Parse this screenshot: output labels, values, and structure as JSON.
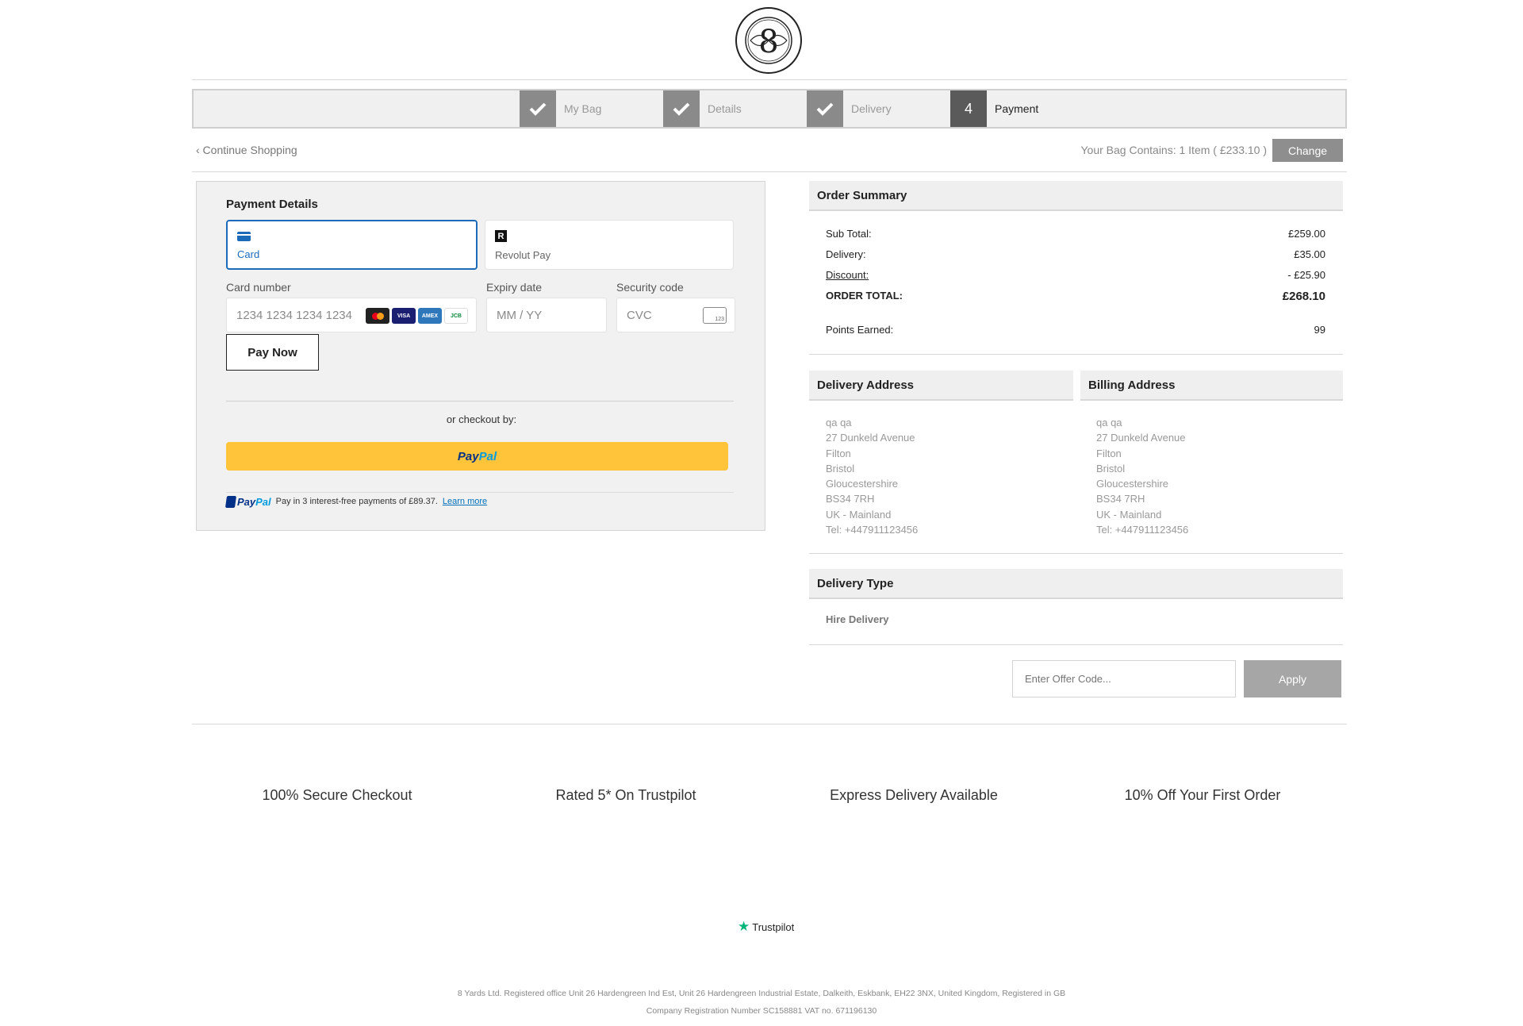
{
  "brand": {
    "logo_text": "EIGHT YARDS · DESIGNED BY ANN · 8",
    "logo_icon": "eight-yards-logo"
  },
  "steps": [
    {
      "label": "My Bag",
      "done": true,
      "icon": "check-icon"
    },
    {
      "label": "Details",
      "done": true,
      "icon": "check-icon"
    },
    {
      "label": "Delivery",
      "done": true,
      "icon": "check-icon"
    },
    {
      "label": "Payment",
      "number": "4",
      "active": true
    }
  ],
  "toolbar": {
    "continue_label": "‹ Continue Shopping",
    "bag_info": "Your Bag Contains: 1 Item ( £233.10 )",
    "change_label": "Change"
  },
  "payment": {
    "title": "Payment Details",
    "tabs": [
      {
        "label": "Card",
        "icon": "credit-card-icon",
        "selected": true
      },
      {
        "label": "Revolut Pay",
        "icon": "revolut-icon",
        "icon_text": "R"
      }
    ],
    "card_number_label": "Card number",
    "card_number_placeholder": "1234 1234 1234 1234",
    "expiry_label": "Expiry date",
    "expiry_placeholder": "MM / YY",
    "security_label": "Security code",
    "security_placeholder": "CVC",
    "cvc_icon_text": "123",
    "brands": [
      "mastercard",
      "VISA",
      "AMEX",
      "JCB"
    ],
    "pay_now_label": "Pay Now",
    "or_checkout": "or checkout by:",
    "paypal_label_1": "Pay",
    "paypal_label_2": "Pal",
    "paylater_text": "Pay in 3 interest-free payments of £89.37.",
    "learn_more": "Learn more",
    "colors": {
      "card_accent": "#1b6bb8",
      "paypal_button": "#ffc439"
    }
  },
  "order_summary": {
    "title": "Order Summary",
    "rows": [
      {
        "label": "Sub Total:",
        "value": "£259.00"
      },
      {
        "label": "Delivery:",
        "value": "£35.00"
      },
      {
        "label": "Discount:",
        "value": "- £25.90"
      },
      {
        "label": "ORDER TOTAL:",
        "value": "£268.10"
      },
      {
        "label": "Points Earned:",
        "value": "99"
      }
    ]
  },
  "delivery_address": {
    "title": "Delivery Address",
    "lines": [
      "qa qa",
      "27 Dunkeld Avenue",
      "Filton",
      "Bristol",
      "Gloucestershire",
      "BS34 7RH",
      "UK - Mainland",
      "Tel: +447911123456"
    ]
  },
  "billing_address": {
    "title": "Billing Address",
    "lines": [
      "qa qa",
      "27 Dunkeld Avenue",
      "Filton",
      "Bristol",
      "Gloucestershire",
      "BS34 7RH",
      "UK - Mainland",
      "Tel: +447911123456"
    ]
  },
  "delivery_type": {
    "title": "Delivery Type",
    "value": "Hire Delivery"
  },
  "offer": {
    "placeholder": "Enter Offer Code...",
    "apply_label": "Apply"
  },
  "features": [
    "100% Secure Checkout",
    "Rated 5* On Trustpilot",
    "Express Delivery Available",
    "10% Off Your First Order"
  ],
  "trustpilot": {
    "label": "Trustpilot",
    "icon": "star-icon"
  },
  "footer": {
    "legal_1": "8 Yards Ltd. Registered office Unit 26 Hardengreen Ind Est, Unit 26 Hardengreen Industrial Estate, Dalkeith, Eskbank, EH22 3NX, United Kingdom, Registered in GB",
    "legal_2": "Company Registration Number SC158881 VAT no. 671196130"
  }
}
